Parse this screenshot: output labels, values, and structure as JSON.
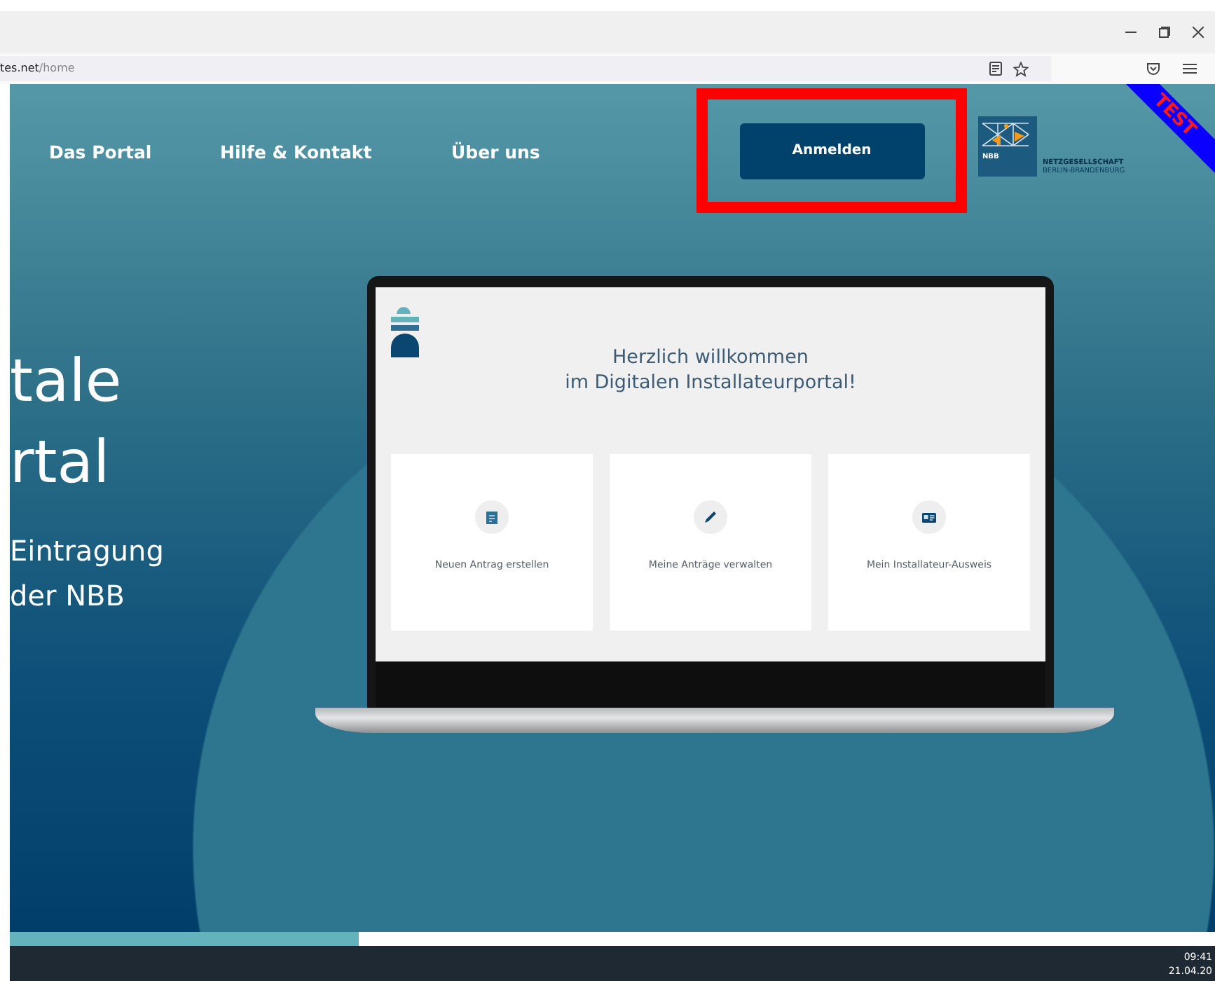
{
  "browser": {
    "url_host": "tes.net",
    "url_path": "/home"
  },
  "nav": {
    "links": [
      "Das Portal",
      "Hilfe & Kontakt",
      "Über uns"
    ],
    "login_button": "Anmelden",
    "highlighted": true
  },
  "logo": {
    "abbr": "NBB",
    "name": "NETZGESELLSCHAFT",
    "subtitle": "BERLIN-BRANDENBURG"
  },
  "ribbon": "TEST",
  "hero": {
    "title_lines": [
      "tale",
      "rtal"
    ],
    "sub_lines": [
      "Eintragung",
      "der NBB"
    ]
  },
  "portal": {
    "heading_lines": [
      "Herzlich willkommen",
      "im Digitalen Installateurportal!"
    ],
    "tiles": [
      {
        "kind": "form",
        "label": "Neuen Antrag erstellen"
      },
      {
        "kind": "pen",
        "label": "Meine Anträge verwalten"
      },
      {
        "kind": "id-card",
        "label": "Mein Installateur-Ausweis"
      }
    ]
  },
  "progress": {
    "level": 0.29
  },
  "taskbar": {
    "time": "09:41",
    "date": "21.04.20"
  }
}
